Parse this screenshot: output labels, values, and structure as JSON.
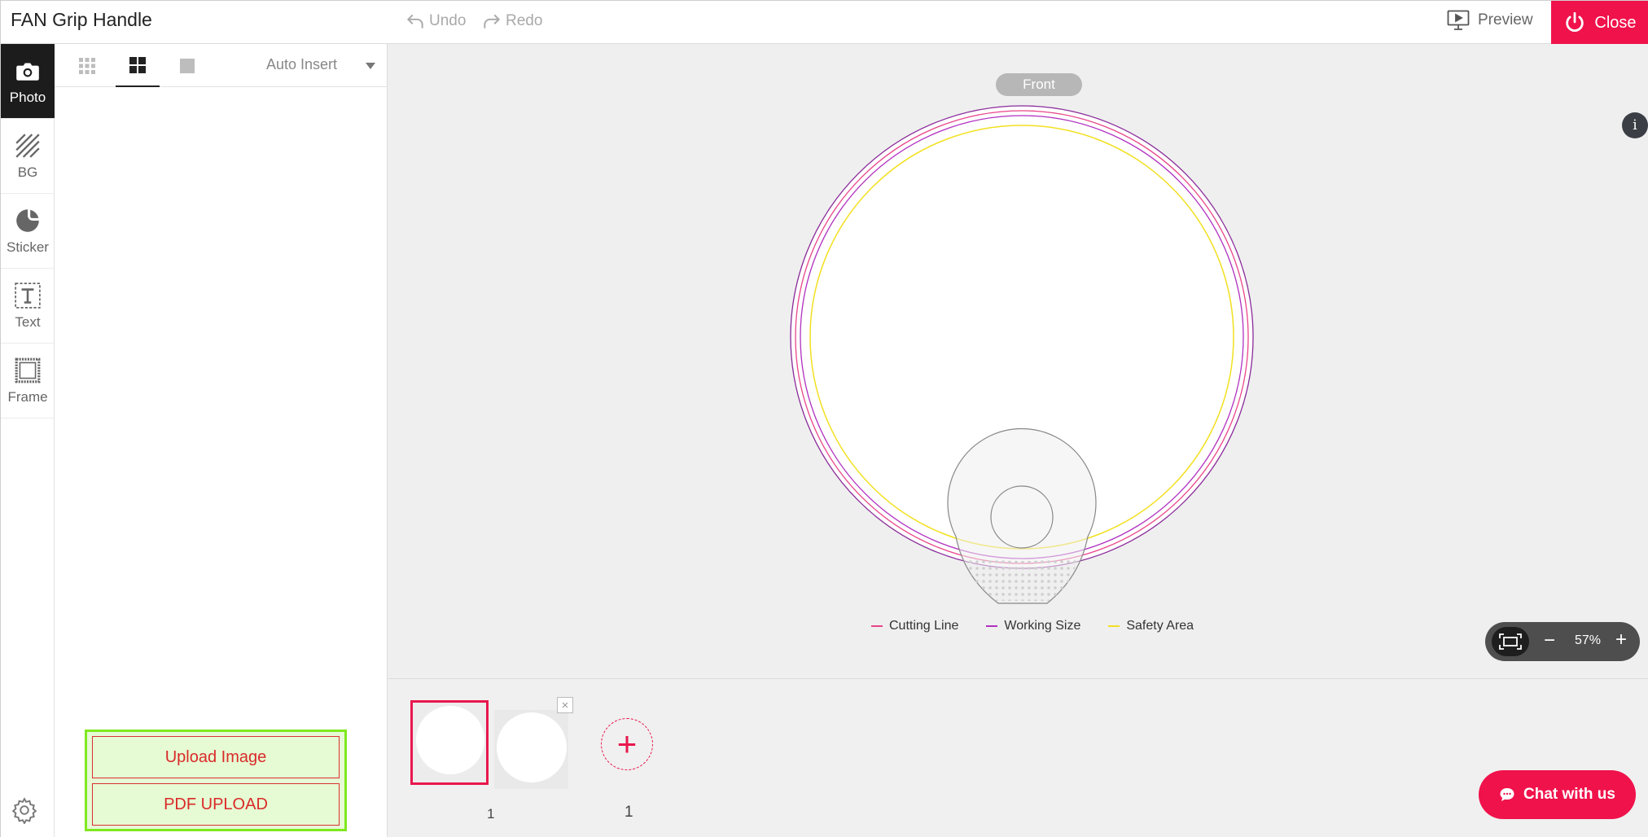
{
  "header": {
    "title": "FAN Grip Handle",
    "undo_label": "Undo",
    "redo_label": "Redo",
    "preview_label": "Preview",
    "close_label": "Close",
    "accent_color": "#f0124b"
  },
  "tools": [
    {
      "label": "Photo",
      "icon": "camera-icon",
      "active": true
    },
    {
      "label": "BG",
      "icon": "hatch-icon"
    },
    {
      "label": "Sticker",
      "icon": "sticker-icon"
    },
    {
      "label": "Text",
      "icon": "text-icon"
    },
    {
      "label": "Frame",
      "icon": "frame-icon"
    }
  ],
  "photo_panel": {
    "auto_insert_label": "Auto Insert",
    "upload_image_label": "Upload Image",
    "pdf_upload_label": "PDF UPLOAD"
  },
  "canvas": {
    "side_label": "Front",
    "legend": [
      {
        "label": "Cutting Line",
        "color": "#e8458a"
      },
      {
        "label": "Working Size",
        "color": "#b030c0"
      },
      {
        "label": "Safety Area",
        "color": "#f2e020"
      }
    ],
    "info_label": "i"
  },
  "zoom": {
    "minus_label": "−",
    "value": "57%",
    "plus_label": "+"
  },
  "pages": {
    "page_number": "1",
    "page_count": "1",
    "remove_label": "×",
    "add_label": "+"
  },
  "chat": {
    "label": "Chat with us"
  }
}
